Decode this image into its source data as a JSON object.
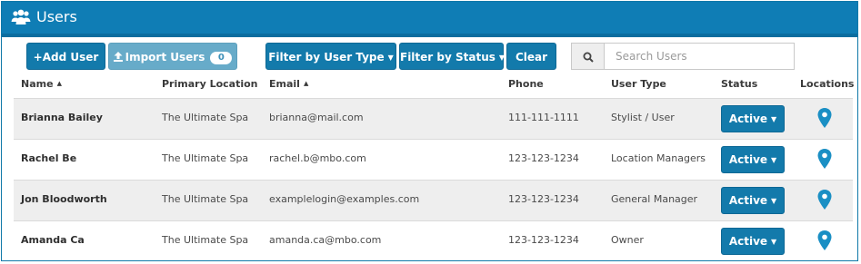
{
  "header": {
    "title": "Users",
    "icon": "users-icon"
  },
  "toolbar": {
    "add_user": "+Add User",
    "import_users": "Import Users",
    "import_count": "0",
    "filter_user_type": "Filter by User Type",
    "filter_status": "Filter by Status",
    "clear": "Clear",
    "search_placeholder": "Search Users"
  },
  "columns": {
    "name": "Name",
    "primary_location": "Primary Location",
    "email": "Email",
    "phone": "Phone",
    "user_type": "User Type",
    "status": "Status",
    "locations": "Locations"
  },
  "rows": [
    {
      "name": "Brianna Bailey",
      "location": "The Ultimate Spa",
      "email": "brianna@mail.com",
      "phone": "111-111-1111",
      "user_type": "Stylist / User",
      "status": "Active"
    },
    {
      "name": "Rachel Be",
      "location": "The Ultimate Spa",
      "email": "rachel.b@mbo.com",
      "phone": "123-123-1234",
      "user_type": "Location Managers",
      "status": "Active"
    },
    {
      "name": "Jon Bloodworth",
      "location": "The Ultimate Spa",
      "email": "examplelogin@examples.com",
      "phone": "123-123-1234",
      "user_type": "General Manager",
      "status": "Active"
    },
    {
      "name": "Amanda Ca",
      "location": "The Ultimate Spa",
      "email": "amanda.ca@mbo.com",
      "phone": "123-123-1234",
      "user_type": "Owner",
      "status": "Active"
    }
  ],
  "colors": {
    "header": "#0f7db5",
    "primary_button": "#137aab",
    "muted_button": "#67abc9",
    "row_alt": "#eeeeee"
  }
}
